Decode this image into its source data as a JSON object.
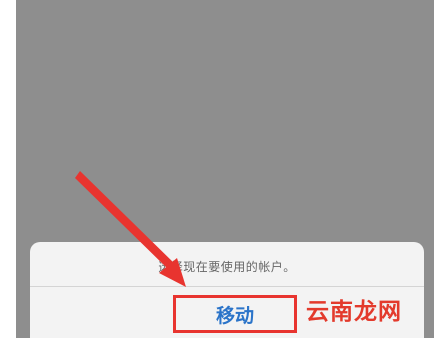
{
  "dialog": {
    "prompt": "选择现在要使用的帐户。",
    "move_label": "移动"
  },
  "watermark": {
    "text": "云南龙网"
  },
  "colors": {
    "screen_dim": "#8e8e8e",
    "sheet_bg": "#f3f3f3",
    "action_text": "#2b74c9",
    "highlight": "#e8342f",
    "watermark": "#e33a2c"
  },
  "icons": {
    "annotation": "red-arrow-icon"
  }
}
